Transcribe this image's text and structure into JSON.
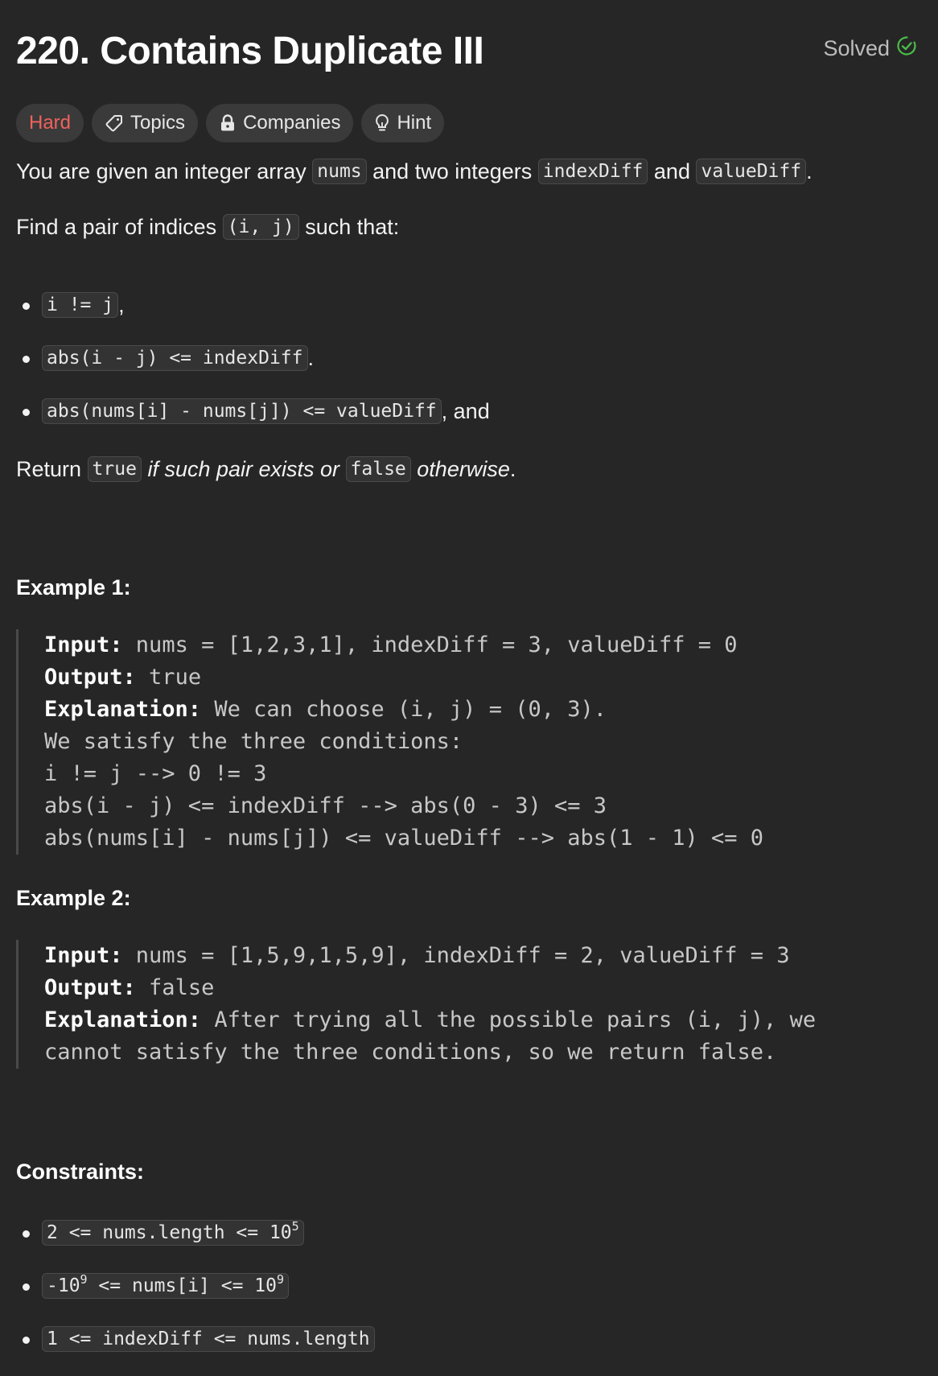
{
  "header": {
    "title": "220. Contains Duplicate III",
    "solved_label": "Solved"
  },
  "tags": {
    "difficulty": "Hard",
    "topics": "Topics",
    "companies": "Companies",
    "hint": "Hint"
  },
  "icons": {
    "tag": "tag-icon",
    "lock": "lock-icon",
    "bulb": "lightbulb-icon",
    "check": "check-circle-icon"
  },
  "colors": {
    "hard": "#f0625d",
    "solved_check": "#4cbb4a"
  },
  "description": {
    "p1": {
      "t1": "You are given an integer array ",
      "c1": "nums",
      "t2": " and two integers ",
      "c2": "indexDiff",
      "t3": " and ",
      "c3": "valueDiff",
      "t4": "."
    },
    "p2": {
      "t1": "Find a pair of indices ",
      "c1": "(i, j)",
      "t2": " such that:"
    },
    "conditions": [
      {
        "code": "i != j",
        "suffix": ","
      },
      {
        "code": "abs(i - j) <= indexDiff",
        "suffix": "."
      },
      {
        "code": "abs(nums[i] - nums[j]) <= valueDiff",
        "suffix": ", and"
      }
    ],
    "p3": {
      "t1": "Return ",
      "c1": "true",
      "e1": " if such pair exists or ",
      "c2": "false",
      "e2": " otherwise",
      "t2": "."
    }
  },
  "examples": [
    {
      "heading": "Example 1:",
      "input_label": "Input:",
      "input": " nums = [1,2,3,1], indexDiff = 3, valueDiff = 0",
      "output_label": "Output:",
      "output": " true",
      "explanation_label": "Explanation:",
      "explanation": " We can choose (i, j) = (0, 3).\nWe satisfy the three conditions:\ni != j --> 0 != 3\nabs(i - j) <= indexDiff --> abs(0 - 3) <= 3\nabs(nums[i] - nums[j]) <= valueDiff --> abs(1 - 1) <= 0"
    },
    {
      "heading": "Example 2:",
      "input_label": "Input:",
      "input": " nums = [1,5,9,1,5,9], indexDiff = 2, valueDiff = 3",
      "output_label": "Output:",
      "output": " false",
      "explanation_label": "Explanation:",
      "explanation": " After trying all the possible pairs (i, j), we\ncannot satisfy the three conditions, so we return false."
    }
  ],
  "constraints": {
    "heading": "Constraints:",
    "items": [
      {
        "pre": "2 <= nums.length <= 10",
        "sup": "5"
      },
      {
        "pre": "-10",
        "sup1": "9",
        "mid": " <= nums[i] <= 10",
        "sup2": "9"
      },
      {
        "pre": "1 <= indexDiff <= nums.length"
      }
    ]
  }
}
